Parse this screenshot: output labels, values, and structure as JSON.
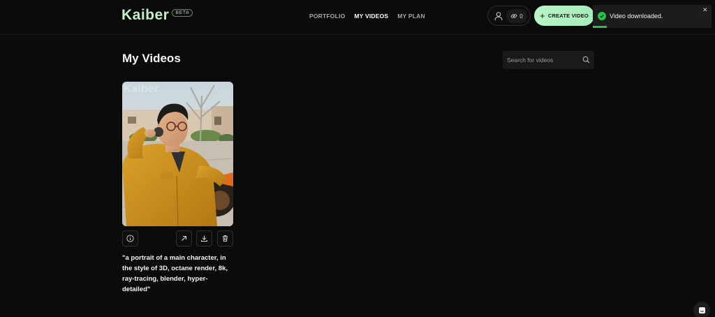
{
  "header": {
    "logo": "Kaiber",
    "badge": "BETA",
    "nav": [
      {
        "label": "PORTFOLIO"
      },
      {
        "label": "MY VIDEOS"
      },
      {
        "label": "MY PLAN"
      }
    ],
    "credits": "0",
    "create_button": "CREATE VIDEO"
  },
  "toast": {
    "message": "Video downloaded.",
    "close": "✕"
  },
  "main": {
    "title": "My Videos",
    "search": {
      "placeholder": "Search for videos"
    },
    "videos": [
      {
        "watermark": "Kaiber",
        "prompt": "\"a portrait of a main character, in the style of 3D, octane render, 8k, ray-tracing, blender, hyper-detailed\""
      }
    ]
  },
  "colors": {
    "background": "#0b0b0b",
    "accent": "#b8f4c6",
    "success": "#27c24c"
  },
  "icons": [
    "user-icon",
    "link-icon",
    "plus-icon",
    "check-icon",
    "close-icon",
    "search-icon",
    "info-icon",
    "share-icon",
    "download-icon",
    "trash-icon",
    "chat-icon"
  ]
}
